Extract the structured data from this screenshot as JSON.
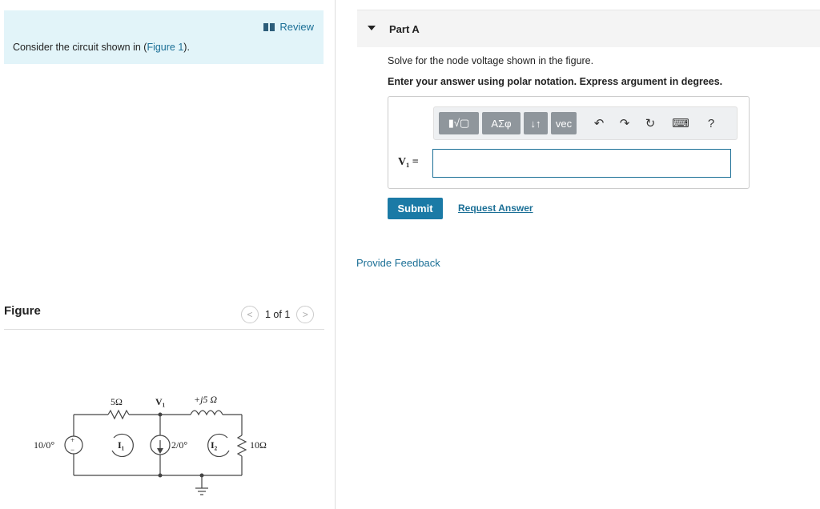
{
  "left": {
    "review_label": "Review",
    "prompt_prefix": "Consider the circuit shown in (",
    "prompt_link": "Figure 1",
    "prompt_suffix": ").",
    "figure_title": "Figure",
    "pager_prev": "<",
    "pager_text": "1 of 1",
    "pager_next": ">"
  },
  "circuit": {
    "r1": "5Ω",
    "v1": "V₁",
    "l1": "+j5 Ω",
    "source_v": "10/0°",
    "plus": "+",
    "minus": "−",
    "mesh1": "I₁",
    "source_i": "2/0°",
    "mesh2": "I₂",
    "r2": "10Ω"
  },
  "part": {
    "title": "Part A",
    "instruction": "Solve for the node voltage shown in the figure.",
    "instruction_bold": "Enter your answer using polar notation. Express argument in degrees.",
    "toolbar": {
      "templates": "▮√▢",
      "greek": "ΑΣφ",
      "updown": "↓↑",
      "vec": "vec",
      "undo": "↶",
      "redo": "↷",
      "reset": "↻",
      "keyboard": "⌨",
      "help": "?"
    },
    "answer_label": "V₁ =",
    "answer_value": "",
    "submit_label": "Submit",
    "request_label": "Request Answer"
  },
  "feedback_label": "Provide Feedback"
}
